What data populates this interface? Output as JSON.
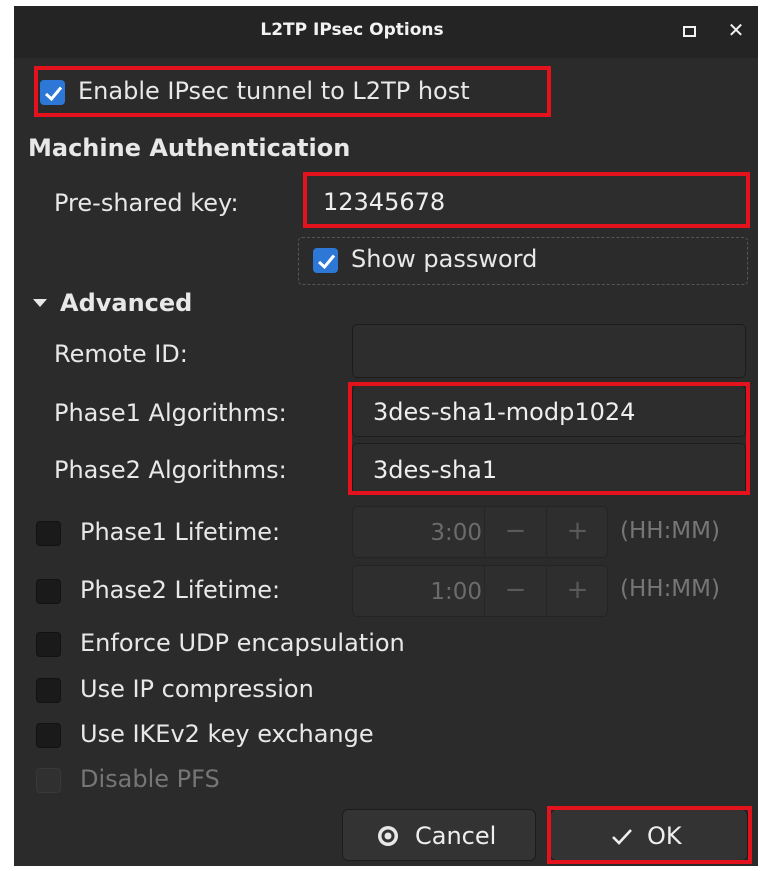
{
  "window": {
    "title": "L2TP IPsec Options"
  },
  "enable_ipsec": {
    "label": "Enable IPsec tunnel to L2TP host",
    "checked": true
  },
  "machine_auth": {
    "heading": "Machine Authentication",
    "psk_label": "Pre-shared key:",
    "psk_value": "12345678",
    "show_password": {
      "label": "Show password",
      "checked": true
    }
  },
  "advanced": {
    "heading": "Advanced",
    "remote_id": {
      "label": "Remote ID:",
      "value": ""
    },
    "phase1_alg": {
      "label": "Phase1 Algorithms:",
      "value": "3des-sha1-modp1024"
    },
    "phase2_alg": {
      "label": "Phase2 Algorithms:",
      "value": "3des-sha1"
    },
    "phase1_lifetime": {
      "label": "Phase1 Lifetime:",
      "value": "3:00",
      "unit": "(HH:MM)",
      "minus": "−",
      "plus": "+",
      "checked": false
    },
    "phase2_lifetime": {
      "label": "Phase2 Lifetime:",
      "value": "1:00",
      "unit": "(HH:MM)",
      "minus": "−",
      "plus": "+",
      "checked": false
    },
    "options": {
      "udp_encap": {
        "label": "Enforce UDP encapsulation",
        "checked": false
      },
      "ip_compression": {
        "label": "Use IP compression",
        "checked": false
      },
      "ikev2": {
        "label": "Use IKEv2 key exchange",
        "checked": false
      },
      "disable_pfs": {
        "label": "Disable PFS",
        "checked": false,
        "enabled": false
      }
    }
  },
  "buttons": {
    "cancel": "Cancel",
    "ok": "OK"
  },
  "colors": {
    "accent": "#2d78d6",
    "highlight": "#e3121d",
    "background": "#2b2b2b"
  }
}
